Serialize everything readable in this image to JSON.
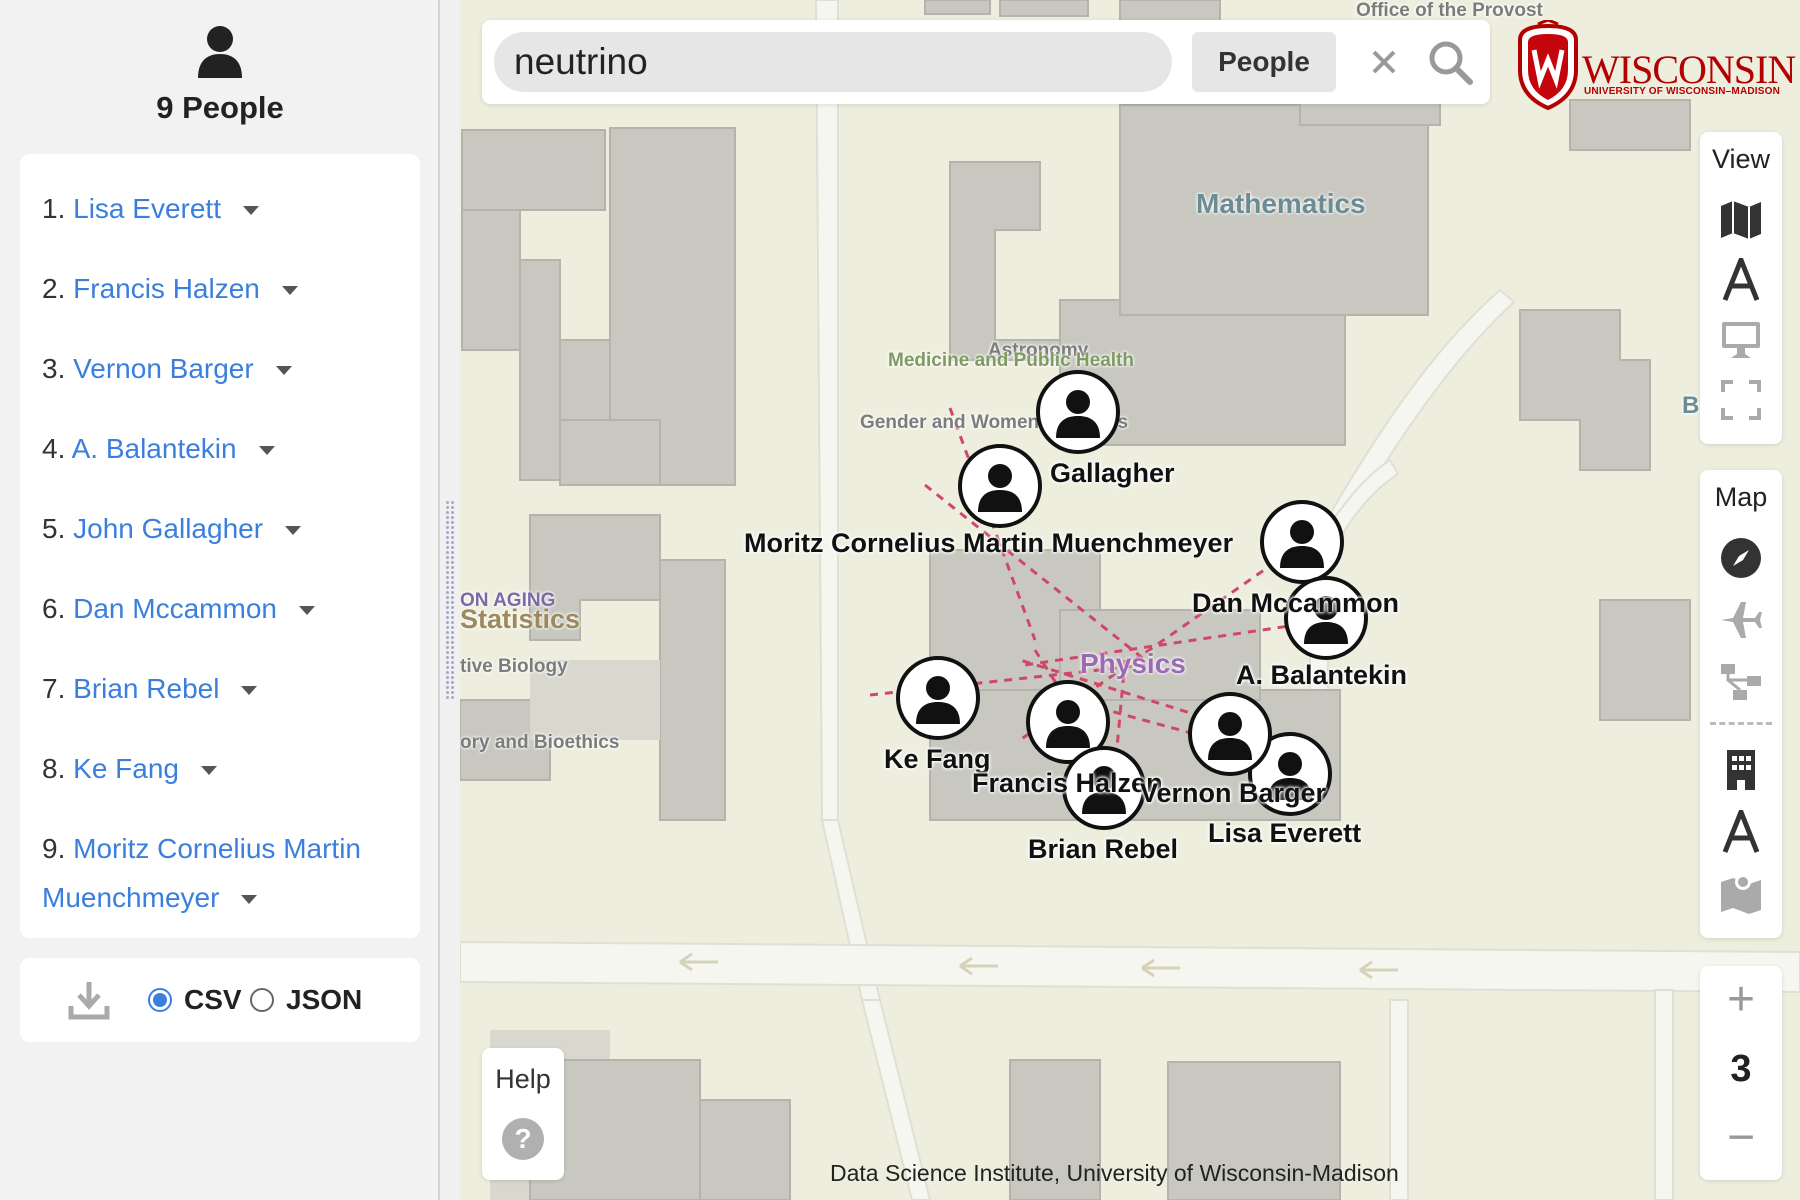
{
  "sidebar": {
    "count_label": "9 People",
    "people": [
      {
        "num": "1.",
        "name": "Lisa Everett"
      },
      {
        "num": "2.",
        "name": "Francis Halzen"
      },
      {
        "num": "3.",
        "name": "Vernon Barger"
      },
      {
        "num": "4.",
        "name": "A. Balantekin"
      },
      {
        "num": "5.",
        "name": "John Gallagher"
      },
      {
        "num": "6.",
        "name": "Dan Mccammon"
      },
      {
        "num": "7.",
        "name": "Brian Rebel"
      },
      {
        "num": "8.",
        "name": "Ke Fang"
      },
      {
        "num": "9.",
        "name": "Moritz Cornelius Martin",
        "name2": "Muenchmeyer"
      }
    ],
    "download": {
      "csv_label": "CSV",
      "json_label": "JSON",
      "selected": "CSV"
    }
  },
  "search": {
    "query": "neutrino",
    "scope": "People"
  },
  "logo": {
    "wordmark": "WISCONSIN",
    "subtitle": "UNIVERSITY OF WISCONSIN–MADISON"
  },
  "map": {
    "labels": {
      "provost": "Office of the Provost",
      "mathematics": "Mathematics",
      "astronomy": "Astronomy",
      "medicine": "Medicine and Public Health",
      "gender": "Gender and Women's Studies",
      "aging": "ON AGING",
      "statistics": "Statistics",
      "biology": "tive Biology",
      "bioethics": "ory and Bioethics",
      "physics": "Physics",
      "edge_b": "B"
    },
    "people_labels": {
      "gallagher": "Gallagher",
      "muenchmeyer": "Moritz Cornelius Martin Muenchmeyer",
      "mccammon": "Dan Mccammon",
      "balantekin": "A. Balantekin",
      "fang": "Ke Fang",
      "halzen": "Francis Halzen",
      "barger": "Vernon Barger",
      "everett": "Lisa Everett",
      "rebel": "Brian Rebel"
    },
    "link_color": "#d0476a",
    "attribution": "Data Science Institute, University of Wisconsin-Madison"
  },
  "controls": {
    "view_title": "View",
    "view_icons": [
      "map-icon",
      "text-icon",
      "monitor-icon",
      "fullscreen-icon"
    ],
    "map_title": "Map",
    "map_icons": [
      "compass-icon",
      "airplane-icon",
      "network-icon",
      "building-icon",
      "text-icon",
      "map-pin-icon"
    ],
    "zoom_in": "+",
    "zoom_level": "3",
    "zoom_out": "−",
    "help_label": "Help",
    "help_icon": "?"
  }
}
